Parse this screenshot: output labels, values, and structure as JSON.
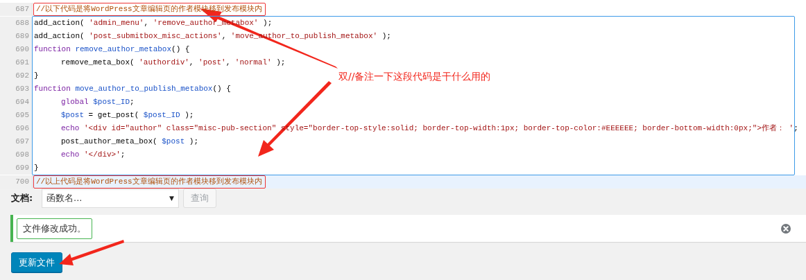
{
  "editor": {
    "groups": [
      {
        "kind": "plain",
        "lines": [
          {
            "number": "687",
            "indent": false,
            "marked": true,
            "current": false,
            "tokens": [
              {
                "kind": "comment",
                "text": "//以下代码是将WordPress文章编辑页的作者模块移到发布模块内"
              }
            ]
          }
        ]
      },
      {
        "kind": "selected",
        "lines": [
          {
            "number": "688",
            "indent": false,
            "marked": false,
            "current": false,
            "tokens": [
              {
                "kind": "plain",
                "text": "add_action( "
              },
              {
                "kind": "str",
                "text": "'admin_menu'"
              },
              {
                "kind": "plain",
                "text": ", "
              },
              {
                "kind": "str",
                "text": "'remove_author_metabox'"
              },
              {
                "kind": "plain",
                "text": " );"
              }
            ]
          },
          {
            "number": "689",
            "indent": false,
            "marked": false,
            "current": false,
            "tokens": [
              {
                "kind": "plain",
                "text": "add_action( "
              },
              {
                "kind": "str",
                "text": "'post_submitbox_misc_actions'"
              },
              {
                "kind": "plain",
                "text": ", "
              },
              {
                "kind": "str",
                "text": "'move_author_to_publish_metabox'"
              },
              {
                "kind": "plain",
                "text": " );"
              }
            ]
          },
          {
            "number": "690",
            "indent": false,
            "marked": false,
            "current": false,
            "tokens": [
              {
                "kind": "kw",
                "text": "function "
              },
              {
                "kind": "fn",
                "text": "remove_author_metabox"
              },
              {
                "kind": "plain",
                "text": "() {"
              }
            ]
          },
          {
            "number": "691",
            "indent": true,
            "marked": false,
            "current": false,
            "tokens": [
              {
                "kind": "plain",
                "text": "remove_meta_box( "
              },
              {
                "kind": "str",
                "text": "'authordiv'"
              },
              {
                "kind": "plain",
                "text": ", "
              },
              {
                "kind": "str",
                "text": "'post'"
              },
              {
                "kind": "plain",
                "text": ", "
              },
              {
                "kind": "str",
                "text": "'normal'"
              },
              {
                "kind": "plain",
                "text": " );"
              }
            ]
          },
          {
            "number": "692",
            "indent": false,
            "marked": false,
            "current": false,
            "tokens": [
              {
                "kind": "plain",
                "text": "}"
              }
            ]
          },
          {
            "number": "693",
            "indent": false,
            "marked": false,
            "current": false,
            "tokens": [
              {
                "kind": "kw",
                "text": "function "
              },
              {
                "kind": "fn",
                "text": "move_author_to_publish_metabox"
              },
              {
                "kind": "plain",
                "text": "() {"
              }
            ]
          },
          {
            "number": "694",
            "indent": true,
            "marked": false,
            "current": false,
            "tokens": [
              {
                "kind": "kw",
                "text": "global "
              },
              {
                "kind": "var",
                "text": "$post_ID"
              },
              {
                "kind": "plain",
                "text": ";"
              }
            ]
          },
          {
            "number": "695",
            "indent": true,
            "marked": false,
            "current": false,
            "tokens": [
              {
                "kind": "var",
                "text": "$post"
              },
              {
                "kind": "plain",
                "text": " = get_post( "
              },
              {
                "kind": "var",
                "text": "$post_ID"
              },
              {
                "kind": "plain",
                "text": " );"
              }
            ]
          },
          {
            "number": "696",
            "indent": true,
            "marked": false,
            "current": false,
            "tokens": [
              {
                "kind": "kw",
                "text": "echo "
              },
              {
                "kind": "str",
                "text": "'<div id=\"author\" class=\"misc-pub-section\" style=\"border-top-style:solid; border-top-width:1px; border-top-color:#EEEEEE; border-bottom-width:0px;\">作者： '"
              },
              {
                "kind": "plain",
                "text": ";"
              }
            ]
          },
          {
            "number": "697",
            "indent": true,
            "marked": false,
            "current": false,
            "tokens": [
              {
                "kind": "plain",
                "text": "post_author_meta_box( "
              },
              {
                "kind": "var",
                "text": "$post"
              },
              {
                "kind": "plain",
                "text": " );"
              }
            ]
          },
          {
            "number": "698",
            "indent": true,
            "marked": false,
            "current": false,
            "tokens": [
              {
                "kind": "kw",
                "text": "echo "
              },
              {
                "kind": "str",
                "text": "'</div>'"
              },
              {
                "kind": "plain",
                "text": ";"
              }
            ]
          },
          {
            "number": "699",
            "indent": false,
            "marked": false,
            "current": false,
            "tokens": [
              {
                "kind": "plain",
                "text": "}"
              }
            ]
          }
        ]
      },
      {
        "kind": "plain",
        "lines": [
          {
            "number": "700",
            "indent": false,
            "marked": true,
            "current": true,
            "tokens": [
              {
                "kind": "comment",
                "text": "//以上代码是将WordPress文章编辑页的作者模块移到发布模块内"
              }
            ]
          }
        ]
      }
    ]
  },
  "annotation": {
    "text": "双//备注一下这段代码是干什么用的"
  },
  "docs": {
    "label": "文档:",
    "select": {
      "value": "函数名...",
      "caret": "▼"
    },
    "lookup_button": {
      "label": "查询",
      "disabled": true
    }
  },
  "notice": {
    "text": "文件修改成功。",
    "marked": true
  },
  "update_button": {
    "label": "更新文件"
  }
}
